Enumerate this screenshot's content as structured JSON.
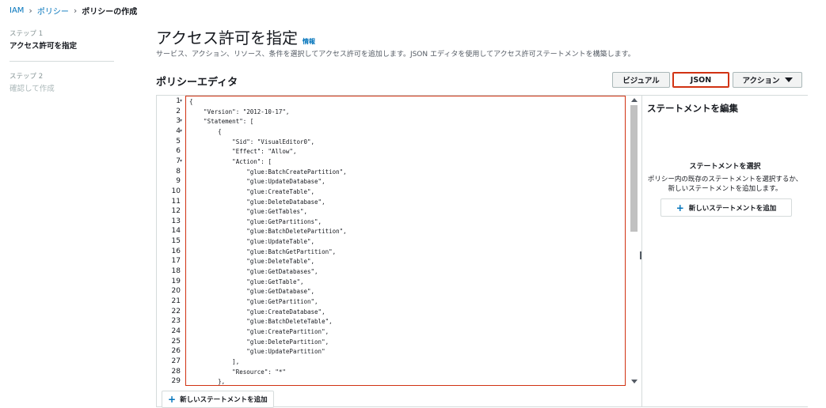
{
  "breadcrumb": {
    "root": "IAM",
    "parent": "ポリシー",
    "current": "ポリシーの作成"
  },
  "steps": [
    {
      "label": "ステップ 1",
      "title": "アクセス許可を指定"
    },
    {
      "label": "ステップ 2",
      "title": "確認して作成"
    }
  ],
  "page": {
    "title": "アクセス許可を指定",
    "info": "情報",
    "description": "サービス、アクション、リソース、条件を選択してアクセス許可を追加します。JSON エディタを使用してアクセス許可ステートメントを構築します。"
  },
  "editor": {
    "title": "ポリシーエディタ",
    "visual_label": "ビジュアル",
    "json_label": "JSON",
    "actions_label": "アクション",
    "add_statement": "新しいステートメントを追加",
    "lines": [
      {
        "n": "1",
        "code": "{",
        "fold": true
      },
      {
        "n": "2",
        "code": "    \"Version\": \"2012-10-17\","
      },
      {
        "n": "3",
        "code": "    \"Statement\": [",
        "fold": true
      },
      {
        "n": "4",
        "code": "        {",
        "fold": true
      },
      {
        "n": "5",
        "code": "            \"Sid\": \"VisualEditor0\","
      },
      {
        "n": "6",
        "code": "            \"Effect\": \"Allow\","
      },
      {
        "n": "7",
        "code": "            \"Action\": [",
        "fold": true
      },
      {
        "n": "8",
        "code": "                \"glue:BatchCreatePartition\","
      },
      {
        "n": "9",
        "code": "                \"glue:UpdateDatabase\","
      },
      {
        "n": "10",
        "code": "                \"glue:CreateTable\","
      },
      {
        "n": "11",
        "code": "                \"glue:DeleteDatabase\","
      },
      {
        "n": "12",
        "code": "                \"glue:GetTables\","
      },
      {
        "n": "13",
        "code": "                \"glue:GetPartitions\","
      },
      {
        "n": "14",
        "code": "                \"glue:BatchDeletePartition\","
      },
      {
        "n": "15",
        "code": "                \"glue:UpdateTable\","
      },
      {
        "n": "16",
        "code": "                \"glue:BatchGetPartition\","
      },
      {
        "n": "17",
        "code": "                \"glue:DeleteTable\","
      },
      {
        "n": "18",
        "code": "                \"glue:GetDatabases\","
      },
      {
        "n": "19",
        "code": "                \"glue:GetTable\","
      },
      {
        "n": "20",
        "code": "                \"glue:GetDatabase\","
      },
      {
        "n": "21",
        "code": "                \"glue:GetPartition\","
      },
      {
        "n": "22",
        "code": "                \"glue:CreateDatabase\","
      },
      {
        "n": "23",
        "code": "                \"glue:BatchDeleteTable\","
      },
      {
        "n": "24",
        "code": "                \"glue:CreatePartition\","
      },
      {
        "n": "25",
        "code": "                \"glue:DeletePartition\","
      },
      {
        "n": "26",
        "code": "                \"glue:UpdatePartition\""
      },
      {
        "n": "27",
        "code": "            ],"
      },
      {
        "n": "28",
        "code": "            \"Resource\": \"*\""
      },
      {
        "n": "29",
        "code": "        },"
      }
    ]
  },
  "side_panel": {
    "title": "ステートメントを編集",
    "subtitle": "ステートメントを選択",
    "description": "ポリシー内の既存のステートメントを選択するか、新しいステートメントを追加します。",
    "add_button": "新しいステートメントを追加"
  }
}
